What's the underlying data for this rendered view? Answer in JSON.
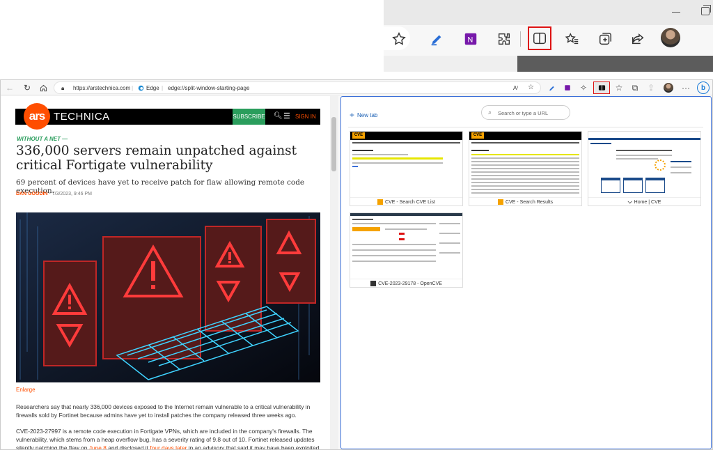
{
  "inset": {
    "icons": [
      "star-icon",
      "pen-icon",
      "onenote-icon",
      "extensions-icon",
      "split-screen-icon",
      "favorites-icon",
      "collections-icon",
      "share-icon",
      "profile-avatar"
    ],
    "highlight_color": "#d11111"
  },
  "browser": {
    "url_host": "https://arstechnica.com",
    "edge_label": "Edge",
    "edge_url": "edge://split-window-starting-page",
    "toolbar_icons": [
      "back-icon",
      "refresh-icon",
      "home-icon",
      "lock-icon",
      "read-aloud-icon",
      "favorite-star-icon",
      "pen-icon",
      "onenote-icon",
      "extensions-icon",
      "split-screen-icon",
      "favorites-icon",
      "collections-icon",
      "share-icon",
      "profile-avatar",
      "more-icon",
      "copilot-icon"
    ]
  },
  "article": {
    "logo": "ars",
    "logo_word": "TECHNICA",
    "subscribe": "SUBSCRIBE",
    "signin": "SIGN IN",
    "kicker": "WITHOUT A NET —",
    "headline": "336,000 servers remain unpatched against critical Fortigate vulnerability",
    "dek": "69 percent of devices have yet to receive patch for flaw allowing remote code execution.",
    "author": "DAN GOODIN",
    "date": " - 7/3/2023, 9:46 PM",
    "enlarge": "Enlarge",
    "para1": "Researchers say that nearly 336,000 devices exposed to the Internet remain vulnerable to a critical vulnerability in firewalls sold by Fortinet because admins have yet to install patches the company released three weeks ago.",
    "para2_a": "CVE-2023-27997 is a remote code execution in Fortigate VPNs, which are included in the company's firewalls. The vulnerability, which stems from a heap overflow bug, has a severity rating of 9.8 out of 10. Fortinet released updates silently patching the flaw on ",
    "para2_link1": "June 8",
    "para2_b": " and disclosed it ",
    "para2_link2": "four days later",
    "para2_c": " in an advisory that said it may have been exploited"
  },
  "split_pane": {
    "new_tab": "New tab",
    "search_placeholder": "Search or type a URL",
    "tabs": [
      {
        "title": "CVE - Search CVE List",
        "favicon_color": "#f5a200"
      },
      {
        "title": "CVE - Search Results",
        "favicon_color": "#f5a200"
      },
      {
        "title": "Home | CVE",
        "favicon_color": "#444444"
      },
      {
        "title": "CVE-2023-29178 - OpenCVE",
        "favicon_color": "#333333"
      }
    ]
  }
}
